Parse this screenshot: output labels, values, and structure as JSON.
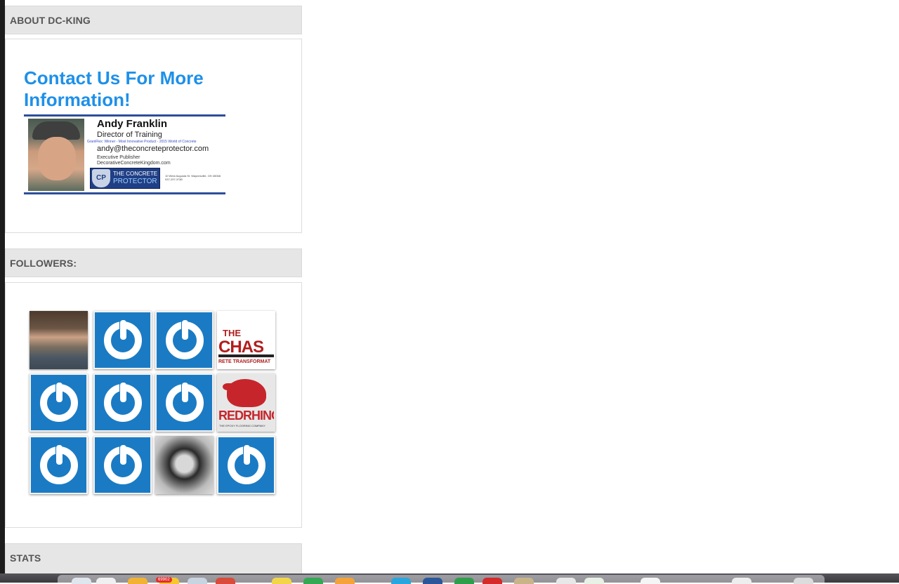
{
  "sidebar": {
    "about": {
      "title": "ABOUT DC-KING",
      "heading": "Contact Us For More Information!",
      "card": {
        "name": "Andy Franklin",
        "role": "Director of Training",
        "award": "GraniFlex:  Winner - Most Innovative Product - 2015 World of Concrete",
        "email": "andy@theconcreteprotector.com",
        "publisher_title": "Executive Publisher",
        "publisher_site": "DecorativeConcreteKingdom.com",
        "logo_mark": "CP",
        "logo_line1": "THE CONCRETE",
        "logo_line2": "PROTECTOR",
        "address": "10 West Augusta St. Waynesville, OH 45068 937-297-3780"
      }
    },
    "followers": {
      "title": "FOLLOWERS:",
      "items": [
        {
          "kind": "photo-man",
          "icon": "follower-photo"
        },
        {
          "kind": "gravatar",
          "icon": "gravatar-power-icon"
        },
        {
          "kind": "gravatar",
          "icon": "gravatar-power-icon"
        },
        {
          "kind": "logo-chase",
          "icon": "chase-logo",
          "text1": "THE",
          "text2": "CHAS",
          "text3": "RETE TRANSFORMAT"
        },
        {
          "kind": "gravatar",
          "icon": "gravatar-power-icon"
        },
        {
          "kind": "gravatar",
          "icon": "gravatar-power-icon"
        },
        {
          "kind": "gravatar",
          "icon": "gravatar-power-icon"
        },
        {
          "kind": "logo-rhino",
          "icon": "red-rhino-logo",
          "text1": "REDRHINO",
          "text2": "THE EPOXY FLOORING COMPANY"
        },
        {
          "kind": "gravatar",
          "icon": "gravatar-power-icon"
        },
        {
          "kind": "gravatar",
          "icon": "gravatar-power-icon"
        },
        {
          "kind": "photo-woman",
          "icon": "follower-photo"
        },
        {
          "kind": "gravatar",
          "icon": "gravatar-power-icon"
        }
      ]
    },
    "stats": {
      "title": "STATS"
    }
  },
  "dock": {
    "mail_badge": "69902"
  },
  "colors": {
    "heading_blue": "#1e90e8",
    "gravatar_blue": "#1a7bc4",
    "widget_title_bg": "#e6e6e6"
  }
}
